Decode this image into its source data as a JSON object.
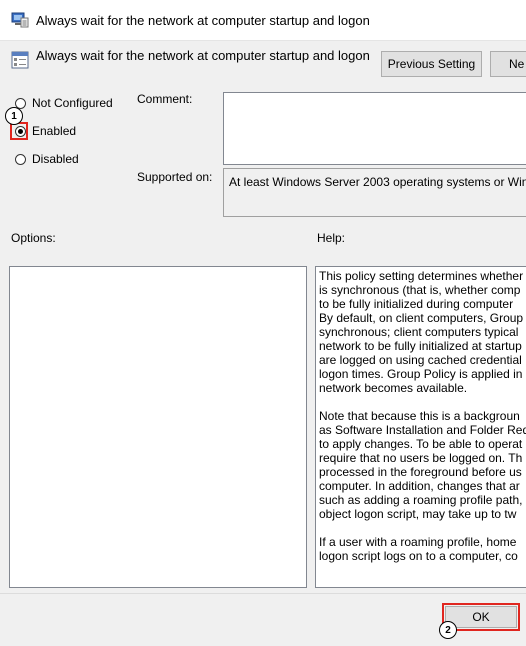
{
  "window": {
    "title": "Always wait for the network at computer startup and logon"
  },
  "header": {
    "setting_name": "Always wait for the network at computer startup and logon",
    "previous_label": "Previous Setting",
    "next_label": "Ne"
  },
  "state": {
    "options": [
      {
        "label": "Not Configured",
        "checked": false
      },
      {
        "label": "Enabled",
        "checked": true
      },
      {
        "label": "Disabled",
        "checked": false
      }
    ]
  },
  "comment": {
    "label": "Comment:",
    "value": ""
  },
  "supported": {
    "label": "Supported on:",
    "value": "At least Windows Server 2003 operating systems or Wind"
  },
  "sections": {
    "options_label": "Options:",
    "help_label": "Help:"
  },
  "help": {
    "paragraphs": [
      [
        "This policy setting determines whether",
        "is synchronous (that is, whether comp",
        "to be fully initialized during computer",
        "By default, on client computers, Group",
        "synchronous; client computers typical",
        "network to be fully initialized at startup",
        "are logged on using cached credential",
        "logon times. Group Policy is applied in",
        "network becomes available."
      ],
      [
        "Note that because this is a backgroun",
        "as Software Installation and Folder Red",
        "to apply changes. To be able to operat",
        "require that no users be logged on. Th",
        "processed in the foreground before us",
        "computer. In addition, changes that ar",
        "such as adding a roaming profile path,",
        "object logon script, may take up to tw"
      ],
      [
        "If a user with a roaming profile, home",
        "logon script logs on to a computer, co"
      ]
    ]
  },
  "footer": {
    "ok_label": "OK"
  },
  "annotations": {
    "step1": "1",
    "step2": "2",
    "highlight_color": "#e0261f"
  }
}
